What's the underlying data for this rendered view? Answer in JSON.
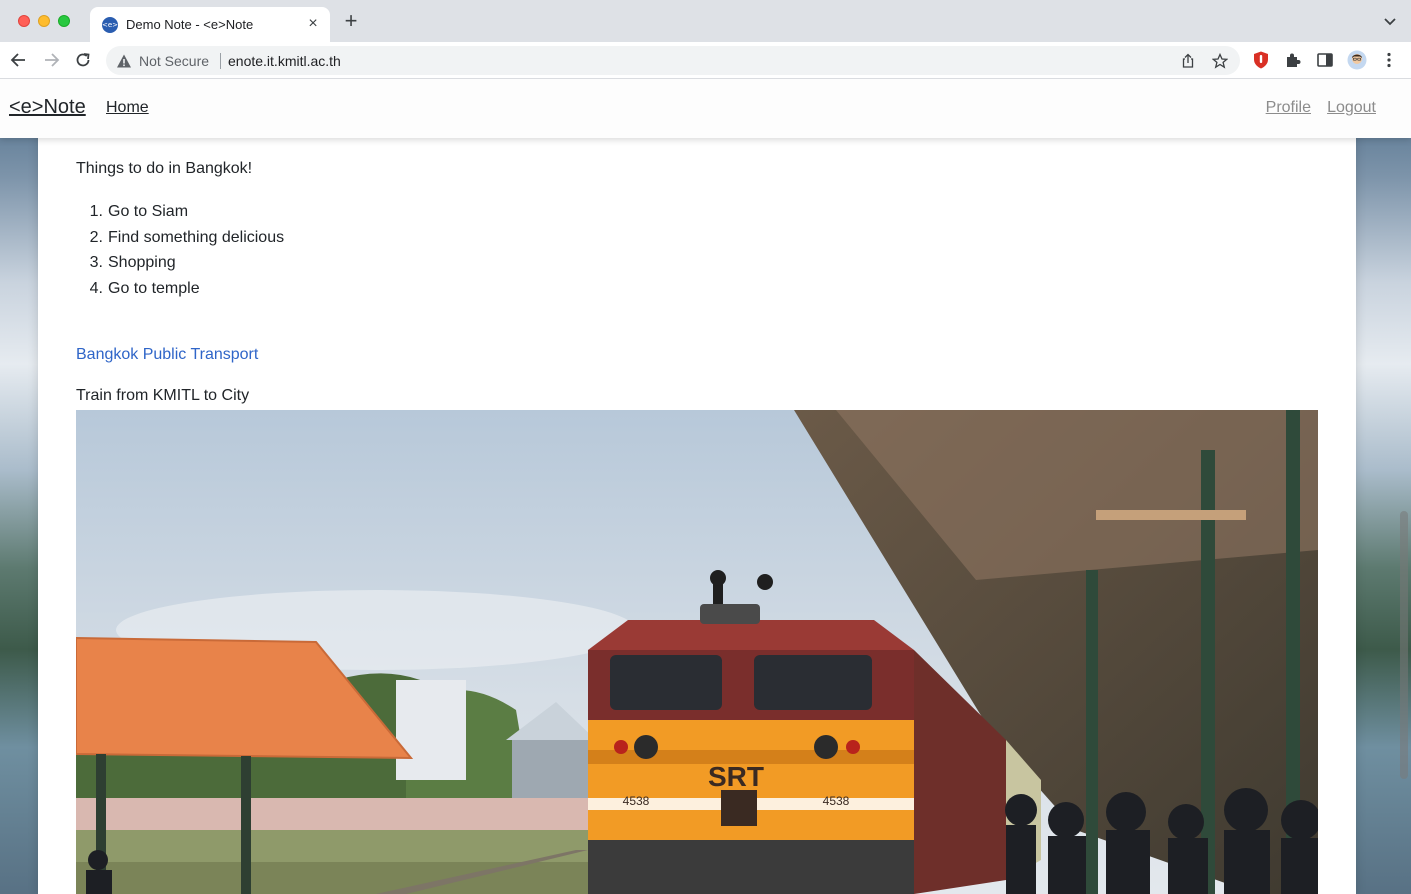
{
  "browser": {
    "tab_title": "Demo Note - <e>Note",
    "favicon_text": "<e>",
    "security_label": "Not Secure",
    "url": "enote.it.kmitl.ac.th"
  },
  "navbar": {
    "brand": "<e>Note",
    "home": "Home",
    "profile": "Profile",
    "logout": "Logout"
  },
  "note": {
    "intro": "Things to do in Bangkok!",
    "items": [
      {
        "num": "1.",
        "text": "Go to Siam"
      },
      {
        "num": "2.",
        "text": "Find something delicious"
      },
      {
        "num": "3.",
        "text": "Shopping"
      },
      {
        "num": "4.",
        "text": "Go to temple"
      }
    ],
    "link": "Bangkok Public Transport",
    "caption": "Train from KMITL to City",
    "photo": {
      "locomotive_text": "SRT",
      "locomotive_number": "4538"
    }
  },
  "colors": {
    "link": "#2f65c8",
    "locomotive": "#f29b25",
    "roof": "#e8834a"
  }
}
